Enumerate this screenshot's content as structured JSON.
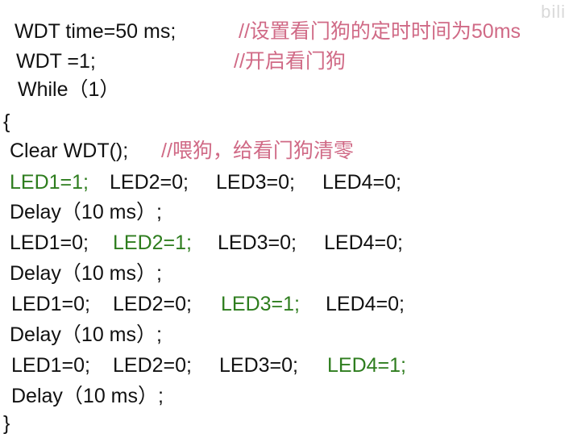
{
  "code": {
    "l1_code": "WDT time=50 ms;",
    "l1_comment": "//设置看门狗的定时时间为50ms",
    "l2_code": "WDT =1;",
    "l2_comment": "//开启看门狗",
    "l3": "While（1）",
    "l4": "{",
    "l5_code": "Clear WDT();",
    "l5_comment": "//喂狗，给看门狗清零",
    "block1": [
      "LED1=1;",
      "LED2=0;",
      "LED3=0;",
      "LED4=0;"
    ],
    "delay1": "Delay（10 ms）;",
    "block2": [
      "LED1=0;",
      "LED2=1;",
      "LED3=0;",
      "LED4=0;"
    ],
    "delay2": "Delay（10 ms）;",
    "block3": [
      "LED1=0;",
      "LED2=0;",
      "LED3=1;",
      "LED4=0;"
    ],
    "delay3": "Delay（10 ms）;",
    "block4": [
      "LED1=0;",
      "LED2=0;",
      "LED3=0;",
      "LED4=1;"
    ],
    "delay4": "Delay（10 ms）;",
    "l_end": "}"
  },
  "colors": {
    "text": "#111111",
    "comment": "#d06a86",
    "led_on": "#2e7d1e"
  },
  "watermark": "bili"
}
